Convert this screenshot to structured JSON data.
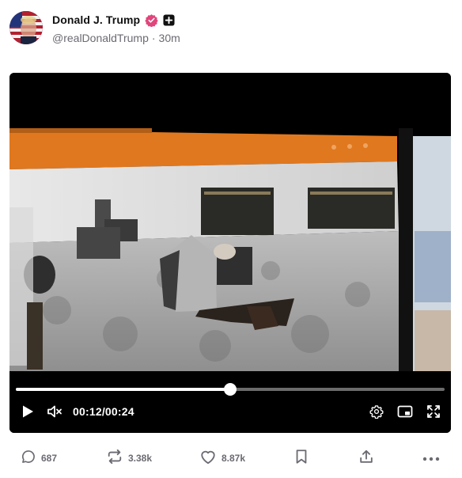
{
  "author": {
    "display_name": "Donald J. Trump",
    "handle": "@realDonaldTrump",
    "separator": "·",
    "time_ago": "30m"
  },
  "video": {
    "current_time": "00:12",
    "time_separator": "/",
    "duration": "00:24",
    "progress_fraction": 0.5,
    "scene": "security camera footage of a lobby displayed on a monitor"
  },
  "actions": {
    "replies": "687",
    "reposts": "3.38k",
    "likes": "8.87k"
  },
  "colors": {
    "verified_badge": "#e0457b",
    "muted_text": "#6a6a72",
    "video_bg": "#000000",
    "progress_track": "#6b6b6b"
  },
  "icons": {
    "verified": "verified-badge-icon",
    "plus": "plus-badge-icon",
    "play": "play-icon",
    "mute": "volume-muted-icon",
    "settings": "gear-icon",
    "pip": "picture-in-picture-icon",
    "fullscreen": "fullscreen-icon",
    "reply": "comment-icon",
    "repost": "repost-icon",
    "like": "heart-icon",
    "bookmark": "bookmark-icon",
    "share": "share-icon",
    "more": "more-icon"
  }
}
